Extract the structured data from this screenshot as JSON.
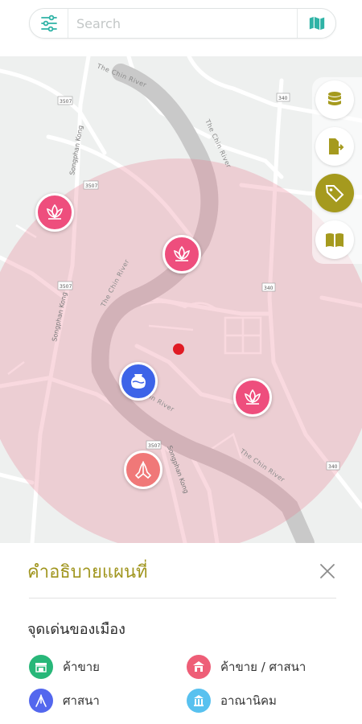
{
  "search": {
    "placeholder": "Search",
    "value": ""
  },
  "map": {
    "rivers": [
      "The Chin River",
      "The Chin River",
      "The Chin River",
      "The Chin River"
    ],
    "roads": [
      "Songphan Kong",
      "Songphan Kong",
      "Songphan Kong"
    ],
    "route_badges": [
      "3507",
      "3507",
      "3507",
      "340",
      "340",
      "340",
      "3507"
    ],
    "markers": [
      {
        "name": "lotus-marker",
        "color": "#ee4e7d"
      },
      {
        "name": "lotus-marker",
        "color": "#ee4e7d"
      },
      {
        "name": "lotus-marker",
        "color": "#ee4e7d"
      },
      {
        "name": "vase-marker",
        "color": "#3d64e8"
      },
      {
        "name": "praying-hands-marker",
        "color": "#f07878"
      }
    ],
    "radius_fill": "rgba(234,120,140,0.28)"
  },
  "rail": {
    "buttons": [
      {
        "name": "database-icon"
      },
      {
        "name": "export-file-icon"
      },
      {
        "name": "tag-icon",
        "active": true
      },
      {
        "name": "book-icon"
      }
    ],
    "accent": "#a59a1e"
  },
  "legend": {
    "title": "คำอธิบายแผนที่",
    "subtitle": "จุดเด่นของเมือง",
    "items": [
      {
        "label": "ค้าขาย",
        "color": "#28b779",
        "icon": "shop-icon"
      },
      {
        "label": "ค้าขาย / ศาสนา",
        "color": "#ee5e77",
        "icon": "shop-temple-icon"
      },
      {
        "label": "ศาสนา",
        "color": "#5367ee",
        "icon": "monk-icon"
      },
      {
        "label": "อาณานิคม",
        "color": "#58c1ef",
        "icon": "colonial-icon"
      }
    ]
  }
}
